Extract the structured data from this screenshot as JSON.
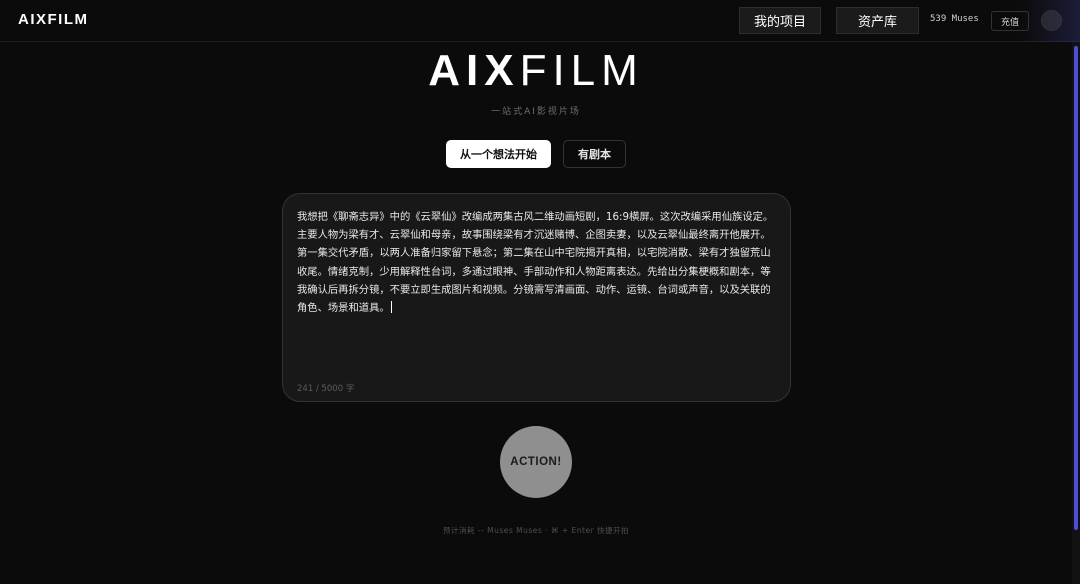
{
  "header": {
    "brand": "AIXFILM",
    "nav": {
      "projects_label": "我的项目",
      "assets_label": "资产库"
    },
    "muses_balance": "539 Muses",
    "recharge_label": "充值"
  },
  "hero": {
    "logo_strong": "AIX",
    "logo_light": "FILM",
    "tagline": "一站式AI影视片场"
  },
  "modes": {
    "idea_label": "从一个想法开始",
    "script_label": "有剧本",
    "selected": "从一个想法开始"
  },
  "prompt": {
    "value": "我想把《聊斋志异》中的《云翠仙》改编成两集古风二维动画短剧，16:9横屏。这次改编采用仙族设定。主要人物为梁有才、云翠仙和母亲，故事围绕梁有才沉迷赌博、企图卖妻，以及云翠仙最终离开他展开。第一集交代矛盾，以两人准备归家留下悬念；第二集在山中宅院揭开真相，以宅院消散、梁有才独留荒山收尾。情绪克制，少用解释性台词，多通过眼神、手部动作和人物距离表达。先给出分集梗概和剧本，等我确认后再拆分镜，不要立即生成图片和视频。分镜需写清画面、动作、运镜、台词或声音，以及关联的角色、场景和道具。",
    "char_count": "241 / 5000 字"
  },
  "action": {
    "label": "ACTION!"
  },
  "footer": {
    "hint": "预计消耗 -- Muses Muses · ⌘ + Enter 快捷开拍"
  },
  "colors": {
    "background": "#0b0b0b",
    "accent_scrollbar": "#4c4fd8",
    "action_button": "#8f8f8f",
    "selected_tab": "#ffffff"
  }
}
